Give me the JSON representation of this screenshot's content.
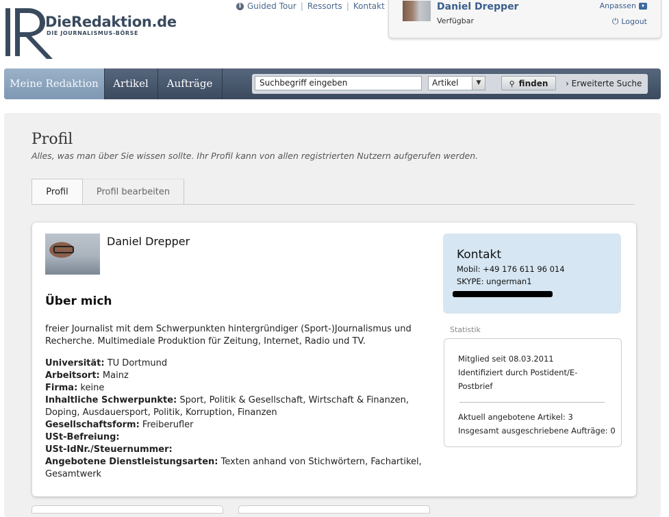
{
  "header": {
    "logo_title": "DieRedaktion.de",
    "logo_subtitle": "DIE JOURNALISMUS-BÖRSE",
    "links": [
      "Guided Tour",
      "Ressorts",
      "Kontakt"
    ],
    "user": {
      "name": "Daniel Drepper",
      "status": "Verfügbar",
      "customize": "Anpassen",
      "logout": "Logout"
    }
  },
  "nav": {
    "tabs": [
      "Meine Redaktion",
      "Artikel",
      "Aufträge"
    ],
    "search_placeholder": "Suchbegriff eingeben",
    "search_category": "Artikel",
    "search_button": "finden",
    "advanced_search": "Erweiterte Suche"
  },
  "page": {
    "title": "Profil",
    "subtitle": "Alles, was man über Sie wissen sollte. Ihr Profil kann von allen registrierten Nutzern aufgerufen werden.",
    "tabs": [
      "Profil",
      "Profil bearbeiten"
    ]
  },
  "profile": {
    "name": "Daniel Drepper",
    "about_title": "Über mich",
    "about_text": "freier Journalist mit dem Schwerpunkten hintergründiger (Sport-)Journalismus und Recherche. Multimediale Produktion für Zeitung, Internet, Radio und TV.",
    "details": [
      {
        "label": "Universität:",
        "value": "TU Dortmund"
      },
      {
        "label": "Arbeitsort:",
        "value": "Mainz"
      },
      {
        "label": "Firma:",
        "value": "keine"
      },
      {
        "label": "Inhaltliche Schwerpunkte:",
        "value": "Sport, Politik & Gesellschaft, Wirtschaft & Finanzen, Doping, Ausdauersport, Politik, Korruption, Finanzen"
      },
      {
        "label": "Gesellschaftsform:",
        "value": "Freiberufler"
      },
      {
        "label": "USt-Befreiung:",
        "value": ""
      },
      {
        "label": "USt-IdNr./Steuernummer:",
        "value": ""
      },
      {
        "label": "Angebotene Dienstleistungsarten:",
        "value": "Texten anhand von Stichwörtern, Fachartikel, Gesamtwerk"
      }
    ]
  },
  "contact": {
    "title": "Kontakt",
    "mobile": "Mobil: +49 176 611 96 014",
    "skype": "SKYPE: ungerman1"
  },
  "stats": {
    "label": "Statistik",
    "member_since": "Mitglied seit 08.03.2011",
    "identified_1": "Identifiziert durch Postident/E-",
    "identified_2": "Postbrief",
    "articles": "Aktuell angebotene Artikel: 3",
    "orders": "Insgesamt ausgeschriebene Aufträge: 0"
  }
}
